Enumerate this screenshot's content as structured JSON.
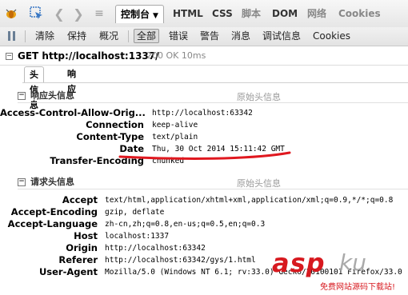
{
  "toolbar": {
    "console_tab": "控制台",
    "tabs": [
      "HTML",
      "CSS",
      "脚本",
      "DOM",
      "网络",
      "Cookies"
    ]
  },
  "filterbar": {
    "clear": "清除",
    "persist": "保持",
    "profile": "概况",
    "filters": [
      "全部",
      "错误",
      "警告",
      "消息",
      "调试信息",
      "Cookies"
    ],
    "selected": "全部"
  },
  "request": {
    "line": "GET http://localhost:1337/",
    "status": "200 OK 10ms"
  },
  "subtabs": [
    "头信息",
    "响应"
  ],
  "response_headers": {
    "title": "响应头信息",
    "raw": "原始头信息",
    "rows": [
      {
        "name": "Access-Control-Allow-Orig...",
        "value": "http://localhost:63342"
      },
      {
        "name": "Connection",
        "value": "keep-alive"
      },
      {
        "name": "Content-Type",
        "value": "text/plain"
      },
      {
        "name": "Date",
        "value": "Thu, 30 Oct 2014 15:11:42 GMT"
      },
      {
        "name": "Transfer-Encoding",
        "value": "chunked"
      }
    ]
  },
  "request_headers": {
    "title": "请求头信息",
    "raw": "原始头信息",
    "rows": [
      {
        "name": "Accept",
        "value": "text/html,application/xhtml+xml,application/xml;q=0.9,*/*;q=0.8"
      },
      {
        "name": "Accept-Encoding",
        "value": "gzip, deflate"
      },
      {
        "name": "Accept-Language",
        "value": "zh-cn,zh;q=0.8,en-us;q=0.5,en;q=0.3"
      },
      {
        "name": "Host",
        "value": "localhost:1337"
      },
      {
        "name": "Origin",
        "value": "http://localhost:63342"
      },
      {
        "name": "Referer",
        "value": "http://localhost:63342/gys/1.html"
      },
      {
        "name": "User-Agent",
        "value": "Mozilla/5.0 (Windows NT 6.1; rv:33.0) Gecko/20100101 Firefox/33.0"
      }
    ]
  },
  "watermark": {
    "brand": "asp",
    "suffix": "ku",
    "tagline": "免费网站源码下载站!"
  },
  "colors": {
    "annotation_red": "#e0181f"
  },
  "icons": [
    "firebug-icon",
    "inspect-icon",
    "back-icon",
    "forward-icon",
    "split-icon",
    "pause-icon",
    "twisty-icon"
  ]
}
